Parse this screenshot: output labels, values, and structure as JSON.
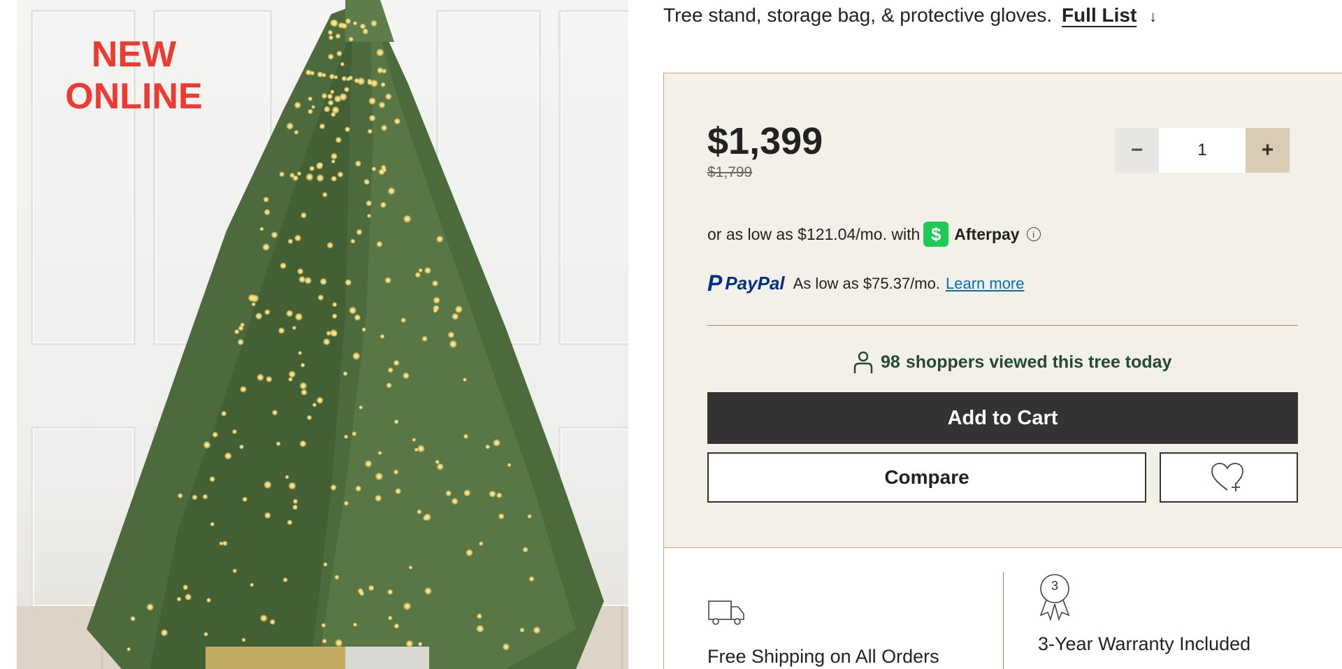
{
  "product_image": {
    "badge_line1": "NEW",
    "badge_line2": "ONLINE",
    "badge_color": "#ee3a2f"
  },
  "includes": {
    "text": "Tree stand, storage bag, & protective gloves.",
    "link_label": "Full List",
    "arrow": "↓"
  },
  "pricing": {
    "current_price": "$1,399",
    "original_price": "$1,799"
  },
  "quantity": {
    "minus_label": "−",
    "value": "1",
    "plus_label": "+"
  },
  "afterpay": {
    "text": "or as low as $121.04/mo. with",
    "logo_glyph": "$",
    "brand": "Afterpay",
    "info_glyph": "i",
    "brand_color": "#1ec95a"
  },
  "paypal": {
    "logo_glyph": "P",
    "brand": "PayPal",
    "text": "As low as $75.37/mo.",
    "link_label": "Learn more"
  },
  "social_proof": {
    "count": "98",
    "text": "shoppers viewed this tree today"
  },
  "actions": {
    "add_to_cart_label": "Add to Cart",
    "compare_label": "Compare"
  },
  "perks": {
    "shipping_label": "Free Shipping on All Orders",
    "warranty_number": "3",
    "warranty_label": "3-Year Warranty Included"
  },
  "colors": {
    "buy_box_bg": "#f3f0ea",
    "accent_border": "#c9a67e",
    "cart_button": "#333333",
    "viewers_text": "#244a36"
  }
}
